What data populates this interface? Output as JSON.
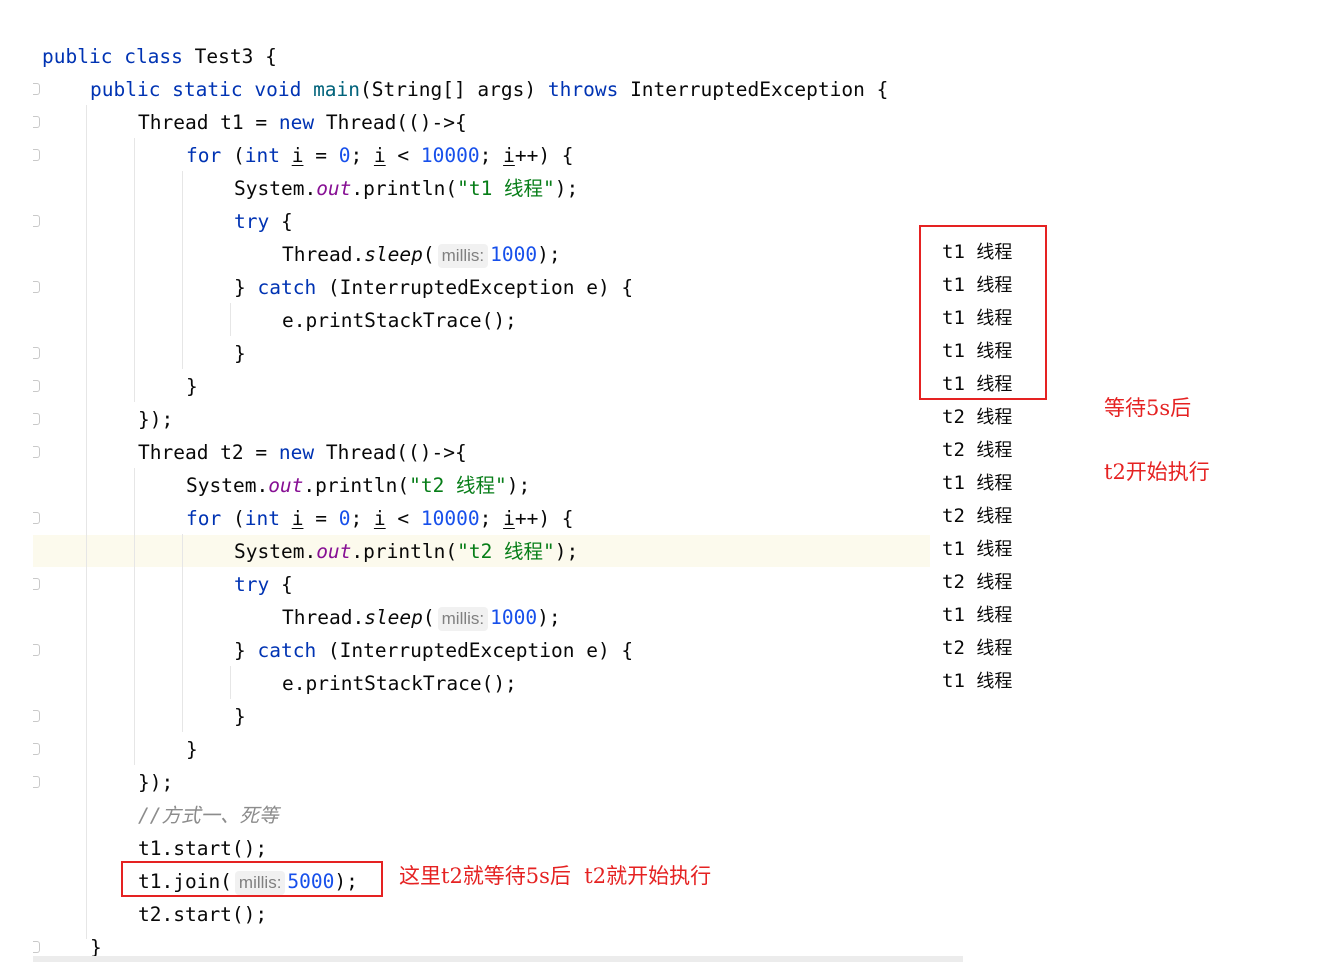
{
  "code": {
    "line_class": [
      "public class Test3 {"
    ],
    "main_decl": {
      "kw": "public static void ",
      "name": "main",
      "rest": "(String[] args) ",
      "throws": "throws",
      "tail": " InterruptedException {"
    },
    "t1": {
      "decl_pre": "Thread t1 = ",
      "new": "new",
      "decl_post": " Thread(()->{",
      "for_kw": "for",
      "int_kw": "int",
      "i": "i",
      "zero": "0",
      "limit": "10000",
      "println_pre": "System.",
      "out": "out",
      "println_mid": ".println(",
      "str": "\"t1 线程\"",
      "println_end": ");",
      "try": "try",
      "brace_open": " {",
      "sleep_pre": "Thread.",
      "sleep": "sleep",
      "hint": "millis:",
      "sleep_val": "1000",
      "sleep_end": ");",
      "catch_close": "} ",
      "catch": "catch",
      "catch_rest": " (InterruptedException e) {",
      "trace": "e.printStackTrace();",
      "close_brace": "}",
      "close_thread": "});"
    },
    "t2": {
      "decl_pre": "Thread t2 = ",
      "new": "new",
      "decl_post": " Thread(()->{",
      "str": "\"t2 线程\""
    },
    "comment": "//方式一、死等",
    "start_t1": "t1.start();",
    "join_pre": "t1.join(",
    "join_hint": "millis:",
    "join_val": "5000",
    "join_end": ");",
    "start_t2": "t2.start();",
    "class_close": "}"
  },
  "console": {
    "lines": [
      {
        "tag": "t1",
        "text": "线程"
      },
      {
        "tag": "t1",
        "text": "线程"
      },
      {
        "tag": "t1",
        "text": "线程"
      },
      {
        "tag": "t1",
        "text": "线程"
      },
      {
        "tag": "t1",
        "text": "线程"
      },
      {
        "tag": "t2",
        "text": "线程"
      },
      {
        "tag": "t2",
        "text": "线程"
      },
      {
        "tag": "t1",
        "text": "线程"
      },
      {
        "tag": "t2",
        "text": "线程"
      },
      {
        "tag": "t1",
        "text": "线程"
      },
      {
        "tag": "t2",
        "text": "线程"
      },
      {
        "tag": "t1",
        "text": "线程"
      },
      {
        "tag": "t2",
        "text": "线程"
      },
      {
        "tag": "t1",
        "text": "线程"
      }
    ]
  },
  "annotations": {
    "wait_note": "等待5s后",
    "start_note": "t2开始执行",
    "join_note": "这里t2就等待5s后  t2就开始执行"
  },
  "colors": {
    "keyword": "#0033b3",
    "number": "#1750eb",
    "string": "#067d17",
    "field": "#871094",
    "annotation": "#e52222"
  }
}
